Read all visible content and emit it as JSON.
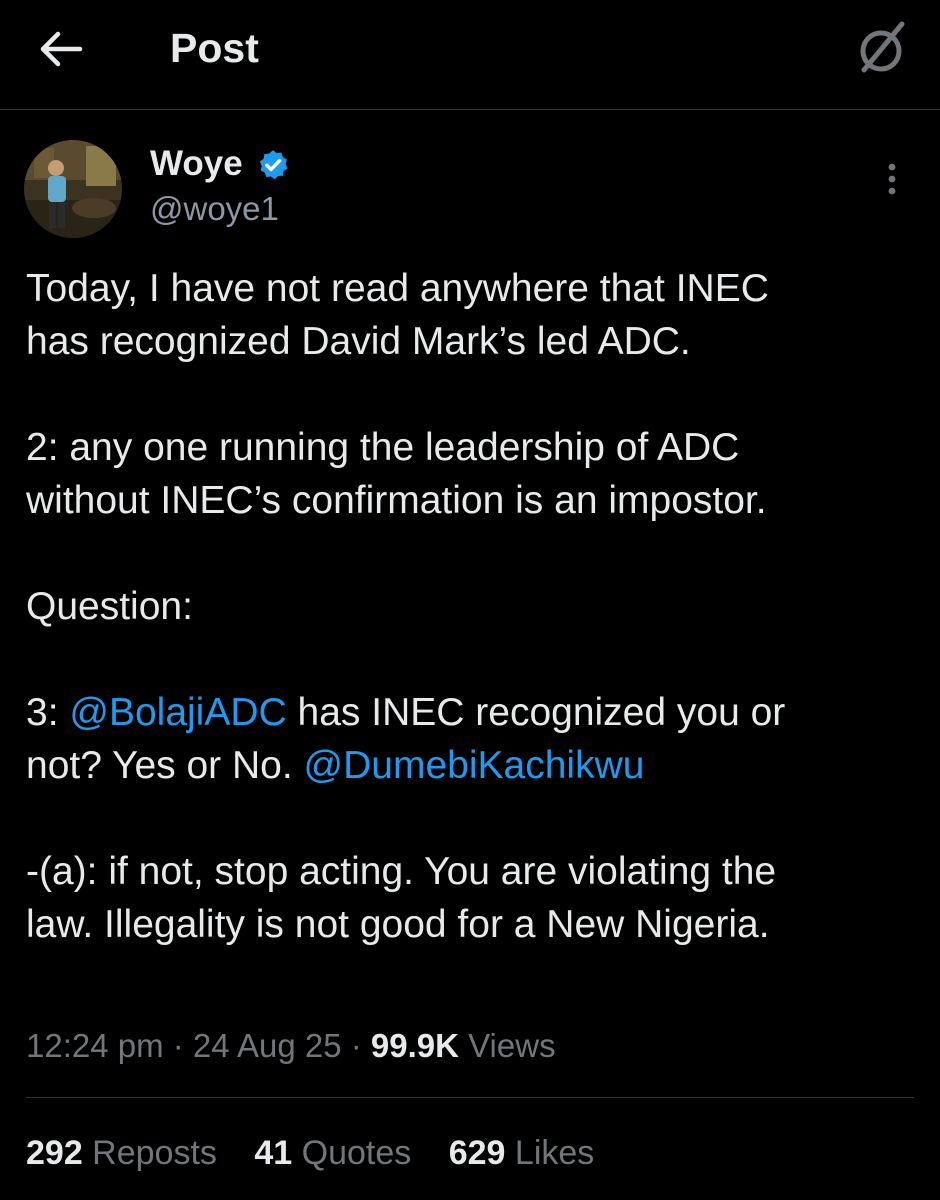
{
  "header": {
    "title": "Post",
    "back_icon": "arrow-left-icon",
    "grok_icon": "grok-icon"
  },
  "author": {
    "name": "Woye",
    "handle": "@woye1",
    "verified_color": "#1d9bf0"
  },
  "tweet": {
    "p1_line1": "Today, I have not read anywhere that INEC",
    "p1_line2": "has recognized David Mark’s led ADC.",
    "p2_line1": "2: any one running the leadership of ADC",
    "p2_line2": "without INEC’s confirmation is an impostor.",
    "p3": "Question:",
    "p4_prefix": "3: ",
    "p4_mention1": "@BolajiADC",
    "p4_text1": " has INEC recognized you or",
    "p4_text2": "not? Yes or No. ",
    "p4_mention2": "@DumebiKachikwu",
    "p5_line1": "-(a): if not, stop acting. You are violating the",
    "p5_line2": "law. Illegality is not good for a New Nigeria."
  },
  "meta": {
    "time": "12:24 pm",
    "sep1": " · ",
    "date": "24 Aug 25",
    "sep2": " · ",
    "views_count": "99.9K",
    "views_label": " Views"
  },
  "stats": {
    "reposts_count": "292",
    "reposts_label": " Reposts",
    "quotes_count": "41",
    "quotes_label": " Quotes",
    "likes_count": "629",
    "likes_label": " Likes"
  },
  "colors": {
    "background": "#000000",
    "text": "#e7e9ea",
    "secondary": "#71767b",
    "link": "#1d9bf0"
  }
}
